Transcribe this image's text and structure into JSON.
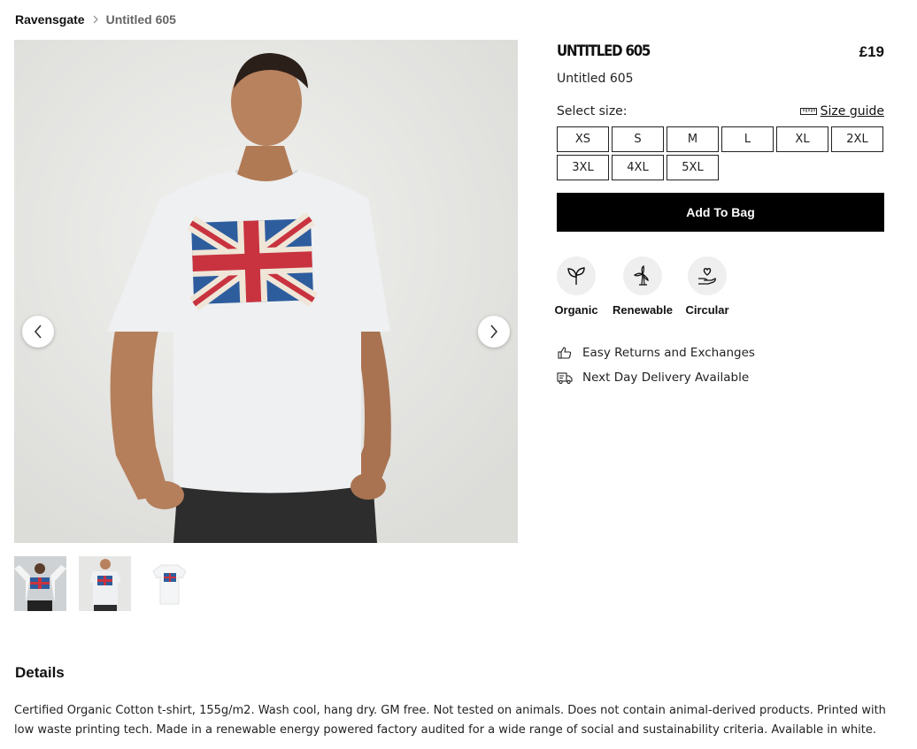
{
  "breadcrumb": {
    "home": "Ravensgate",
    "separator": "›",
    "current": "Untitled 605"
  },
  "gallery": {
    "prev_label": "‹",
    "next_label": "›",
    "thumb_count": 3
  },
  "product": {
    "name": "UNTITLED 605",
    "price": "£19",
    "subtitle": "Untitled 605"
  },
  "sizing": {
    "select_label": "Select size:",
    "guide_label": "Size guide",
    "options": [
      "XS",
      "S",
      "M",
      "L",
      "XL",
      "2XL",
      "3XL",
      "4XL",
      "5XL"
    ]
  },
  "cta": {
    "add_to_bag": "Add To Bag"
  },
  "badges": [
    {
      "label": "Organic",
      "icon": "sprout-icon"
    },
    {
      "label": "Renewable",
      "icon": "wind-turbine-icon"
    },
    {
      "label": "Circular",
      "icon": "hand-heart-icon"
    }
  ],
  "perks": [
    {
      "label": "Easy Returns and Exchanges",
      "icon": "thumbs-up-icon"
    },
    {
      "label": "Next Day Delivery Available",
      "icon": "delivery-truck-icon"
    }
  ],
  "details": {
    "title": "Details",
    "text": "Certified Organic Cotton t-shirt, 155g/m2. Wash cool, hang dry. GM free. Not tested on animals. Does not contain animal-derived products. Printed with low waste printing tech. Made in a renewable energy powered factory audited for a wide range of social and sustainability criteria. Available in white."
  },
  "colors": {
    "cta_bg": "#000000",
    "badge_bg": "#efefef",
    "photo_bg": "#e9e9e7",
    "flag_red": "#c8333f",
    "flag_blue": "#2e5d9e"
  }
}
